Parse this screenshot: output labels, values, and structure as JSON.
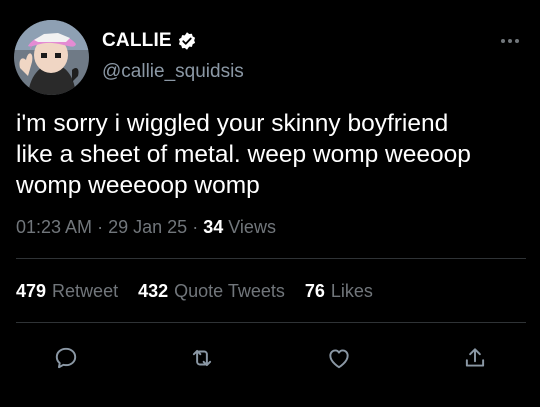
{
  "author": {
    "display_name": "CALLIE",
    "handle": "@callie_squidsis",
    "verified": true,
    "avatar_icon": "avatar-image"
  },
  "tweet": {
    "text": "i'm sorry i wiggled your skinny boyfriend\nlike a sheet of metal. weep womp weeoop\nwomp weeeoop womp"
  },
  "meta": {
    "time": "01:23 AM",
    "separator": "·",
    "date": "29 Jan 25",
    "views_count": "34",
    "views_label": "Views"
  },
  "stats": {
    "retweets_count": "479",
    "retweets_label": "Retweet",
    "quotes_count": "432",
    "quotes_label": "Quote Tweets",
    "likes_count": "76",
    "likes_label": "Likes"
  },
  "actions": [
    {
      "name": "reply",
      "icon": "reply-icon"
    },
    {
      "name": "retweet",
      "icon": "retweet-icon"
    },
    {
      "name": "like",
      "icon": "heart-icon"
    },
    {
      "name": "share",
      "icon": "share-icon"
    }
  ],
  "colors": {
    "background": "#000000",
    "text": "#ffffff",
    "secondary": "#71767b",
    "handle": "#8b98a5",
    "accent": "#1d9bf0",
    "divider": "#2f3336"
  }
}
